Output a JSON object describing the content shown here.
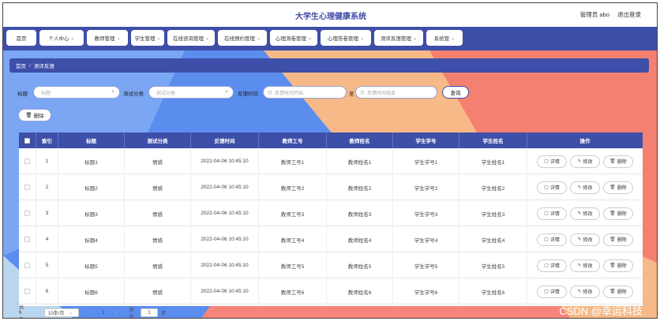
{
  "header": {
    "site_title": "大学生心理健康系统",
    "user_label": "管理员 abo",
    "logout_label": "退出登录"
  },
  "nav": {
    "items": [
      {
        "label": "首页",
        "has_menu": false
      },
      {
        "label": "个人中心",
        "has_menu": true
      },
      {
        "label": "教师管理",
        "has_menu": true
      },
      {
        "label": "学生管理",
        "has_menu": true
      },
      {
        "label": "在线咨询管理",
        "has_menu": true
      },
      {
        "label": "在线预约管理",
        "has_menu": true
      },
      {
        "label": "心理测卷管理",
        "has_menu": true
      },
      {
        "label": "心理答卷管理",
        "has_menu": true
      },
      {
        "label": "测评反馈管理",
        "has_menu": true
      },
      {
        "label": "系统管",
        "has_menu": true
      }
    ]
  },
  "breadcrumb": {
    "home": "首页",
    "separator": "/",
    "current": "测评反馈"
  },
  "filters": {
    "title_label": "标题",
    "title_placeholder": "标题",
    "category_label": "测试分类",
    "category_placeholder": "测试分类",
    "time_label": "反馈时间",
    "start_placeholder": "反馈时间开始",
    "to_label": "至",
    "end_placeholder": "反馈时间结束",
    "search_label": "查询",
    "delete_label": "删除"
  },
  "table": {
    "headers": {
      "index": "索引",
      "title": "标题",
      "category": "测试分类",
      "time": "反馈时间",
      "teacher_no": "教师工号",
      "teacher_name": "教师姓名",
      "student_no": "学生学号",
      "student_name": "学生姓名",
      "actions": "操作"
    },
    "actions": {
      "detail": "详情",
      "edit": "修改",
      "delete": "删除"
    },
    "rows": [
      {
        "index": "1",
        "title": "标题1",
        "category": "情感",
        "time": "2022-04-06 10:45:10",
        "teacher_no": "教师工号1",
        "teacher_name": "教师姓名1",
        "student_no": "学生学号1",
        "student_name": "学生姓名1"
      },
      {
        "index": "2",
        "title": "标题2",
        "category": "情感",
        "time": "2022-04-06 10:45:10",
        "teacher_no": "教师工号2",
        "teacher_name": "教师姓名2",
        "student_no": "学生学号2",
        "student_name": "学生姓名2"
      },
      {
        "index": "3",
        "title": "标题3",
        "category": "情感",
        "time": "2022-04-06 10:45:10",
        "teacher_no": "教师工号3",
        "teacher_name": "教师姓名3",
        "student_no": "学生学号3",
        "student_name": "学生姓名3"
      },
      {
        "index": "4",
        "title": "标题4",
        "category": "情感",
        "time": "2022-04-06 10:45:10",
        "teacher_no": "教师工号4",
        "teacher_name": "教师姓名4",
        "student_no": "学生学号4",
        "student_name": "学生姓名4"
      },
      {
        "index": "5",
        "title": "标题5",
        "category": "情感",
        "time": "2022-04-06 10:45:10",
        "teacher_no": "教师工号5",
        "teacher_name": "教师姓名5",
        "student_no": "学生学号5",
        "student_name": "学生姓名5"
      },
      {
        "index": "6",
        "title": "标题6",
        "category": "情感",
        "time": "2022-04-06 10:45:10",
        "teacher_no": "教师工号6",
        "teacher_name": "教师姓名6",
        "student_no": "学生学号6",
        "student_name": "学生姓名6"
      }
    ]
  },
  "pagination": {
    "total_text": "共 6 条",
    "page_size": "10条/页",
    "prev": "<",
    "current_page": "1",
    "next": ">",
    "goto_label": "前往",
    "goto_value": "1",
    "page_suffix": "页"
  },
  "watermark": "CSDN @幸运科技",
  "colors": {
    "primary": "#3d4fa8",
    "bg_blue": "#5b8def",
    "bg_orange": "#f3b27f",
    "bg_coral": "#f38070"
  }
}
